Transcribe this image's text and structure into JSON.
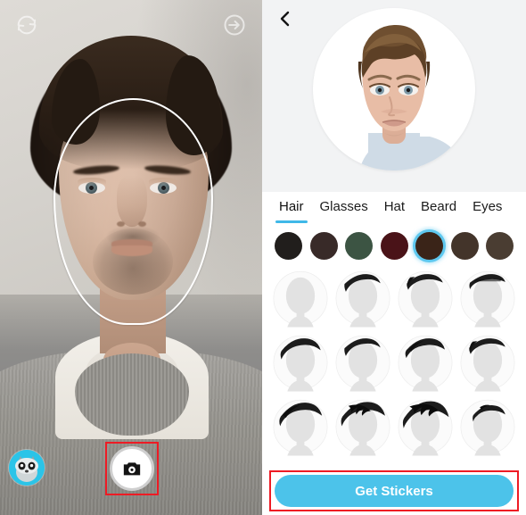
{
  "camera": {
    "flip_icon": "camera-flip-icon",
    "next_icon": "forward-circle-icon",
    "shutter_icon": "camera-icon",
    "thumbnail_icon": "avatar-thumbnail-icon",
    "face_guide": "face-oval-guide"
  },
  "editor": {
    "back_icon": "back-chevron-icon",
    "avatar_alt": "avatar-preview",
    "tabs": [
      {
        "label": "Hair",
        "active": true
      },
      {
        "label": "Glasses",
        "active": false
      },
      {
        "label": "Hat",
        "active": false
      },
      {
        "label": "Beard",
        "active": false
      },
      {
        "label": "Eyes",
        "active": false
      }
    ],
    "colors": [
      {
        "hex": "#211e1c",
        "selected": false
      },
      {
        "hex": "#382a28",
        "selected": false
      },
      {
        "hex": "#3c5443",
        "selected": false
      },
      {
        "hex": "#4a1318",
        "selected": false
      },
      {
        "hex": "#3a2418",
        "selected": true
      },
      {
        "hex": "#43342a",
        "selected": false
      },
      {
        "hex": "#4a3d32",
        "selected": false
      }
    ],
    "selected_color": "#3a2418",
    "accent_color": "#3fb8e8",
    "highlight_color": "#ee1b24",
    "hairstyles": [
      {
        "name": "bald",
        "coverage": 0,
        "style": "none"
      },
      {
        "name": "short-swept-left",
        "coverage": 1,
        "style": "swept"
      },
      {
        "name": "short-side-part",
        "coverage": 1,
        "style": "part"
      },
      {
        "name": "short-flat-top",
        "coverage": 1,
        "style": "flat"
      },
      {
        "name": "medium-fringe",
        "coverage": 2,
        "style": "fringe"
      },
      {
        "name": "medium-swept",
        "coverage": 2,
        "style": "swept"
      },
      {
        "name": "medium-round",
        "coverage": 2,
        "style": "round"
      },
      {
        "name": "medium-side",
        "coverage": 2,
        "style": "part"
      },
      {
        "name": "thick-bowl",
        "coverage": 3,
        "style": "bowl"
      },
      {
        "name": "thick-textured",
        "coverage": 3,
        "style": "textured"
      },
      {
        "name": "thick-voluminous",
        "coverage": 3,
        "style": "volume"
      },
      {
        "name": "thick-short-quiff",
        "coverage": 3,
        "style": "quiff"
      }
    ],
    "cta_label": "Get Stickers"
  }
}
